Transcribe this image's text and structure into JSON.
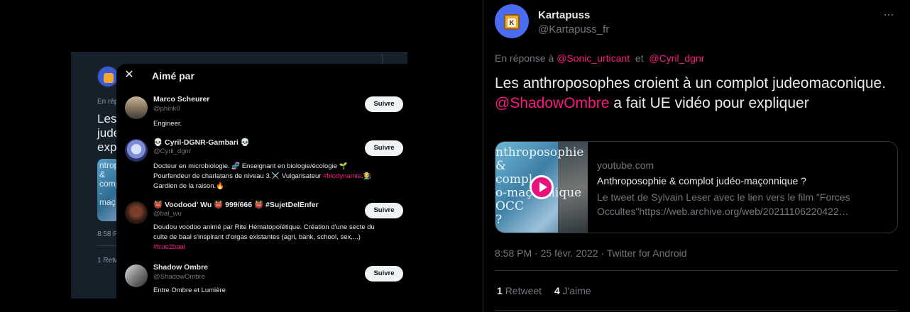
{
  "inner_background": {
    "text_en_rep": "En répo",
    "text_line1": "Les",
    "text_line2": "jude",
    "text_line3": "expli",
    "media_text": "ntroposop\n&\ncomp\n-maç",
    "time_fragment": "8:58 P",
    "retweets_fragment": "1 Retw"
  },
  "liked_by": {
    "title": "Aimé par",
    "close_icon": "close-icon",
    "follow_label": "Suivre",
    "users": [
      {
        "name": "Marco Scheurer",
        "handle": "@phink0",
        "bio": [
          "Engineer."
        ],
        "hashtag": ""
      },
      {
        "name": "💀 Cyril-DGNR-Gambari 💀",
        "handle": "@Cyril_dgnr",
        "bio": [
          "Docteur en microbiologie. 🧬 Enseignant en biologie/écologie 🌱",
          "Pourfendeur de charlatans de niveau 3.⚔️ Vulgarisateur"
        ],
        "hashtag": "#biodynamie",
        "bio_tail": ".🧑‍🌾",
        "bio_line3": "Gardien de la raison.🔥"
      },
      {
        "name": "👹 Voodood' Wu 👹 999/666 👹 #SujetDelEnfer",
        "handle": "@bal_wu",
        "bio": [
          "Doudou voodoo animé par Rite Hématopoïétique. Création d'une secte du",
          "culte de baal s'inspirant d'orgas existantes (agri, bank, school, sex,...)"
        ],
        "hashtag": "#true2baal"
      },
      {
        "name": "Shadow Ombre",
        "handle": "@ShadowOmbre",
        "bio": [
          "Entre Ombre et Lumière"
        ],
        "hashtag": ""
      }
    ]
  },
  "tweet": {
    "author_name": "Kartapuss",
    "author_handle": "@Kartapuss_fr",
    "avatar_letter": "K",
    "more_icon": "more-icon",
    "reply_prefix": "En réponse à",
    "reply_mention_1": "@Sonic_urticant",
    "reply_and": "et",
    "reply_mention_2": "@Cyril_dgnr",
    "text_part1": "Les anthroposophes croient à un complot judeomaconique. ",
    "text_mention": "@ShadowOmbre",
    "text_part2": " a fait UE vidéo pour expliquer",
    "card": {
      "domain": "youtube.com",
      "title": "Anthroposophie & complot judéo-maçonnique ?",
      "description": "Le tweet de Sylvain Leser avec le lien vers le film \"Forces Occultes\"https://web.archive.org/web/20211106220422…",
      "thumb_text": "nthroposophie\n&\ncompl\no-maçonnique\nOCC\n?"
    },
    "meta": "8:58 PM · 25 févr. 2022 · Twitter for Android",
    "retweets_count": "1",
    "retweets_label": "Retweet",
    "likes_count": "4",
    "likes_label": "J'aime"
  },
  "colors": {
    "accent": "#f91880",
    "background": "#000000",
    "inner_background": "#15202b"
  }
}
